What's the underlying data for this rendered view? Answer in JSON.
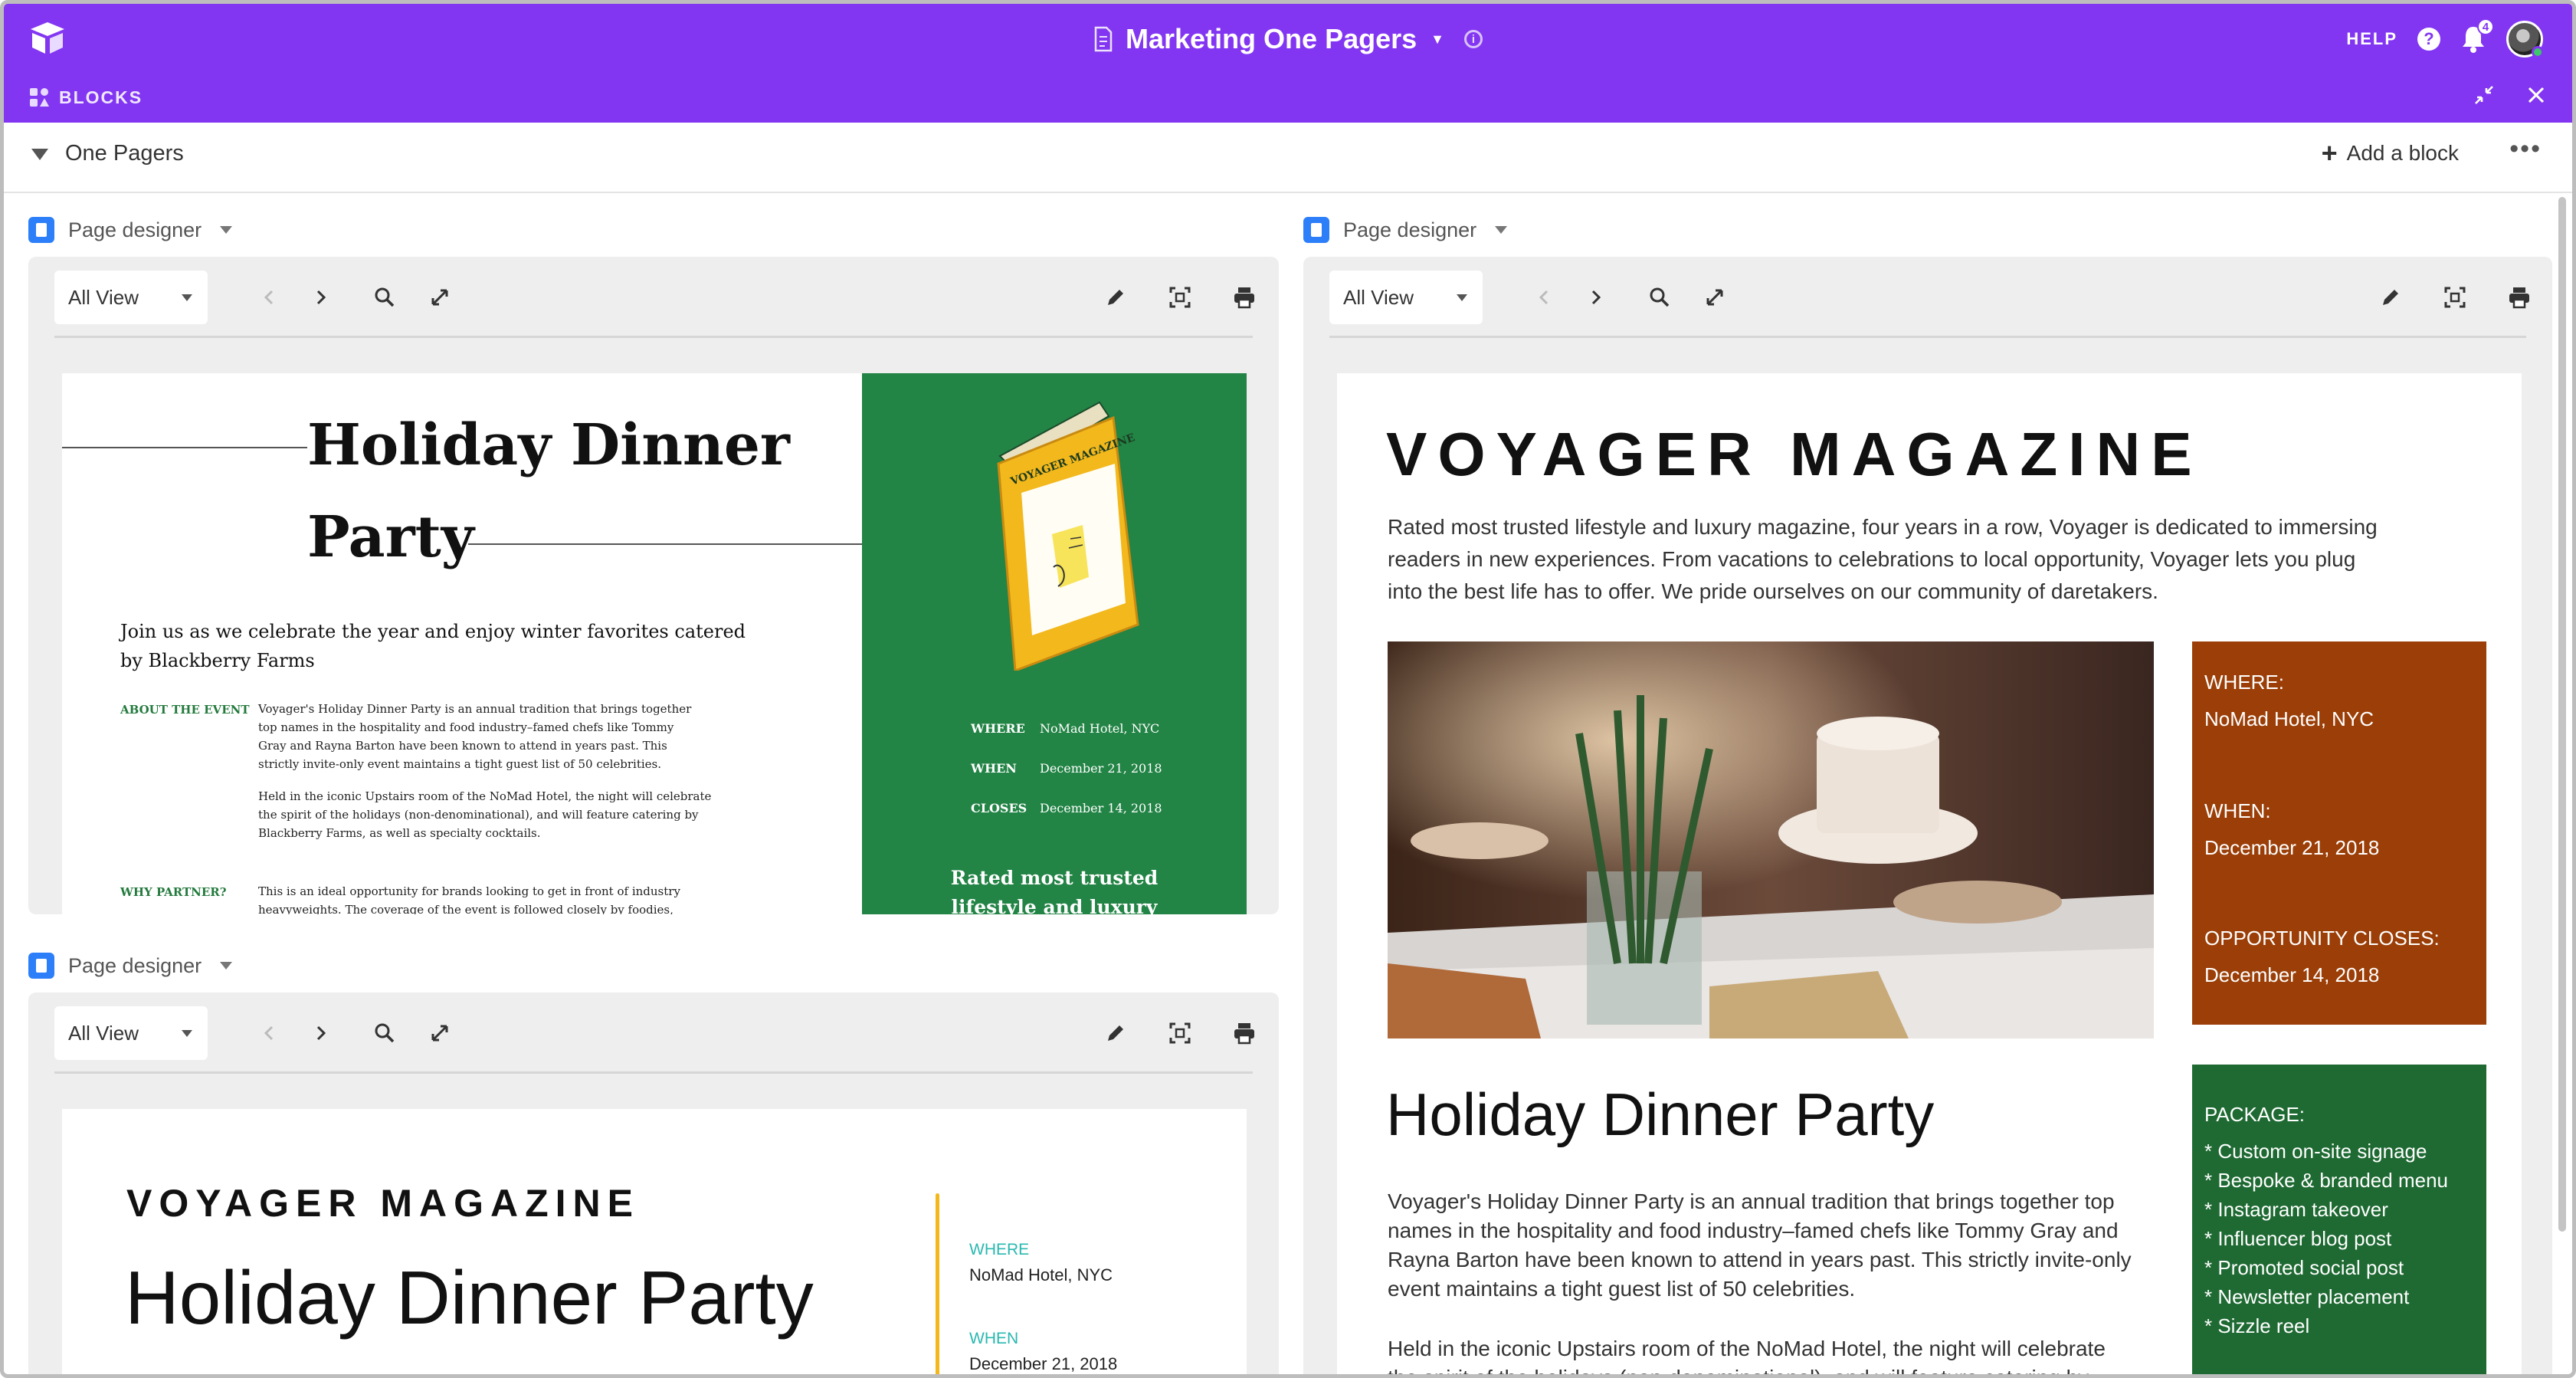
{
  "app": {
    "base_title": "Marketing One Pagers",
    "help_label": "HELP",
    "notification_count": "4",
    "blocks_label": "BLOCKS",
    "accent_color": "#8336f2"
  },
  "dashboard": {
    "title": "One Pagers",
    "add_block_label": "Add a block"
  },
  "blocks": [
    {
      "name": "Page designer",
      "view_label": "All View",
      "page": {
        "title_line1": "Holiday Dinner",
        "title_line2": "Party",
        "lead_line1": "Join us as we celebrate the year and enjoy winter favorites catered",
        "lead_line2": "by Blackberry Farms",
        "about_label": "ABOUT THE EVENT",
        "about_p1": [
          "Voyager's Holiday Dinner Party is an annual tradition that brings together",
          "top names in the hospitality and food industry–famed chefs like Tommy",
          "Gray and Rayna Barton have been known to attend in years past. This",
          "strictly invite-only event maintains a tight guest list of 50 celebrities."
        ],
        "about_p2": [
          "Held in the iconic Upstairs room of the NoMad Hotel, the night will celebrate",
          "the spirit of the holidays (non-denominational), and will feature catering by",
          "Blackberry Farms, as well as specialty cocktails."
        ],
        "why_label": "WHY PARTNER?",
        "why_p": [
          "This is an ideal opportunity for brands looking to get in front of industry",
          "heavyweights. The coverage of the event is followed closely by foodies,"
        ],
        "book_text": "VOYAGER MAGAZINE",
        "where_label": "WHERE",
        "where_value": "NoMad Hotel, NYC",
        "when_label": "WHEN",
        "when_value": "December 21, 2018",
        "closes_label": "CLOSES",
        "closes_value": "December 14, 2018",
        "tagline_line1": "Rated most trusted",
        "tagline_line2": "lifestyle and luxury"
      }
    },
    {
      "name": "Page designer",
      "view_label": "All View",
      "page": {
        "magazine": "VOYAGER MAGAZINE",
        "title": "Holiday Dinner Party",
        "where_label": "WHERE",
        "where_value": "NoMad Hotel, NYC",
        "when_label": "WHEN",
        "when_value": "December 21, 2018"
      }
    },
    {
      "name": "Page designer",
      "view_label": "All View",
      "page": {
        "magazine": "VOYAGER MAGAZINE",
        "intro": [
          "Rated most trusted lifestyle and luxury magazine, four years in a row, Voyager is dedicated to immersing",
          "readers in new experiences. From vacations to celebrations to local opportunity, Voyager lets you plug",
          "into the best life has to offer. We pride ourselves on our community of daretakers."
        ],
        "where_label": "WHERE:",
        "where_value": "NoMad Hotel, NYC",
        "when_label": "WHEN:",
        "when_value": "December 21, 2018",
        "closes_label": "OPPORTUNITY CLOSES:",
        "closes_value": "December 14, 2018",
        "package_label": "PACKAGE:",
        "package_items": [
          "* Custom on-site signage",
          "* Bespoke & branded menu",
          "* Instagram takeover",
          "* Influencer blog post",
          "* Promoted social post",
          "* Newsletter placement",
          "* Sizzle reel"
        ],
        "title": "Holiday Dinner Party",
        "body_p1": [
          "Voyager's Holiday Dinner Party is an annual tradition that brings together top",
          "names in the hospitality and food industry–famed chefs like Tommy Gray and",
          "Rayna Barton have been known to attend in years past. This strictly invite-only",
          "event maintains a tight guest list of 50 celebrities."
        ],
        "body_p2": [
          "Held in the iconic Upstairs room of the NoMad Hotel, the night will celebrate",
          "the spirit of the holidays (non-denominational), and will feature catering by"
        ],
        "orange_color": "#9b3e07",
        "green_color": "#1e6a32"
      }
    }
  ]
}
